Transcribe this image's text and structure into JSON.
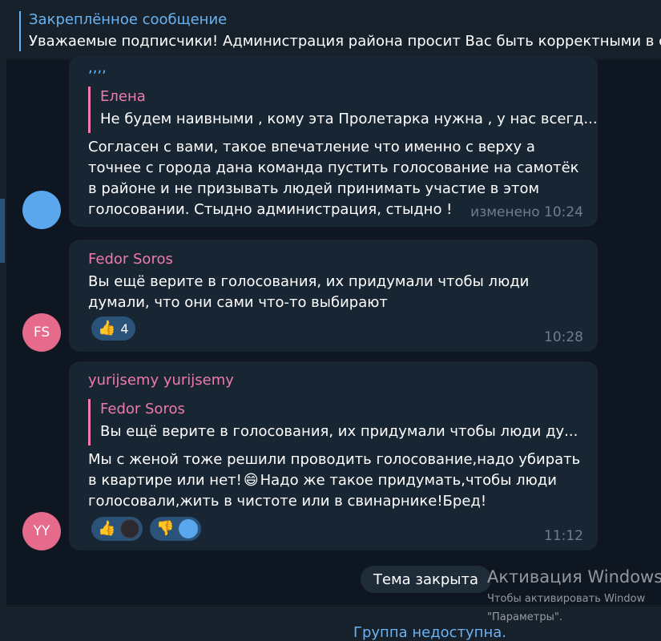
{
  "pinned": {
    "title": "Закреплённое сообщение",
    "text": "Уважаемые подписчики!  Администрация района просит Вас быть корректными в св"
  },
  "messages": [
    {
      "sender": ",,,,",
      "reply": {
        "name": "Елена",
        "text": "Не будем наивными , кому эта Пролетарка нужна , у нас всегд..."
      },
      "lines": [
        "Согласен с вами,  такое впечатление что именно с верху а",
        "точнее с города дана команда пустить голосование на самотёк",
        "в районе и не   призывать людей принимать участие в этом",
        "голосовании. Стыдно администрация, стыдно !"
      ],
      "time": "изменено 10:24"
    },
    {
      "sender": "Fedor Soros",
      "avatar_initials": "FS",
      "lines": [
        "Вы ещё верите в голосования, их придумали чтобы люди",
        "думали, что они сами что-то выбирают"
      ],
      "reactions": [
        {
          "emoji": "👍",
          "count": "4"
        }
      ],
      "time": "10:28"
    },
    {
      "sender": "yurijsemy yurijsemy",
      "avatar_initials": "YY",
      "reply": {
        "name": "Fedor Soros",
        "text": "Вы ещё верите в голосования, их придумали чтобы люди ду..."
      },
      "lines": [
        "Мы с женой тоже решили проводить голосование,надо убирать",
        "в квартире или нет!",
        "Надо же такое придумать,чтобы люди",
        "голосовали,жить в чистоте или в свинарнике!Бред!"
      ],
      "inline_emoji": "😄",
      "reactions": [
        {
          "emoji": "👍"
        },
        {
          "emoji": "👎"
        }
      ],
      "time": "11:12"
    }
  ],
  "topic_closed": "Тема закрыта",
  "footer": {
    "status": "Группа недоступна."
  },
  "watermark": {
    "line1": "Активация Windows",
    "line2": "Чтобы активировать Window",
    "line3": "\"Параметры\"."
  },
  "colors": {
    "accent": "#6ab3f3",
    "sender_pink": "#ee7aae",
    "bubble": "#182533",
    "background": "#0e1621",
    "avatar_blue": "#5aa7ee",
    "avatar_pink": "#e56a8c"
  }
}
